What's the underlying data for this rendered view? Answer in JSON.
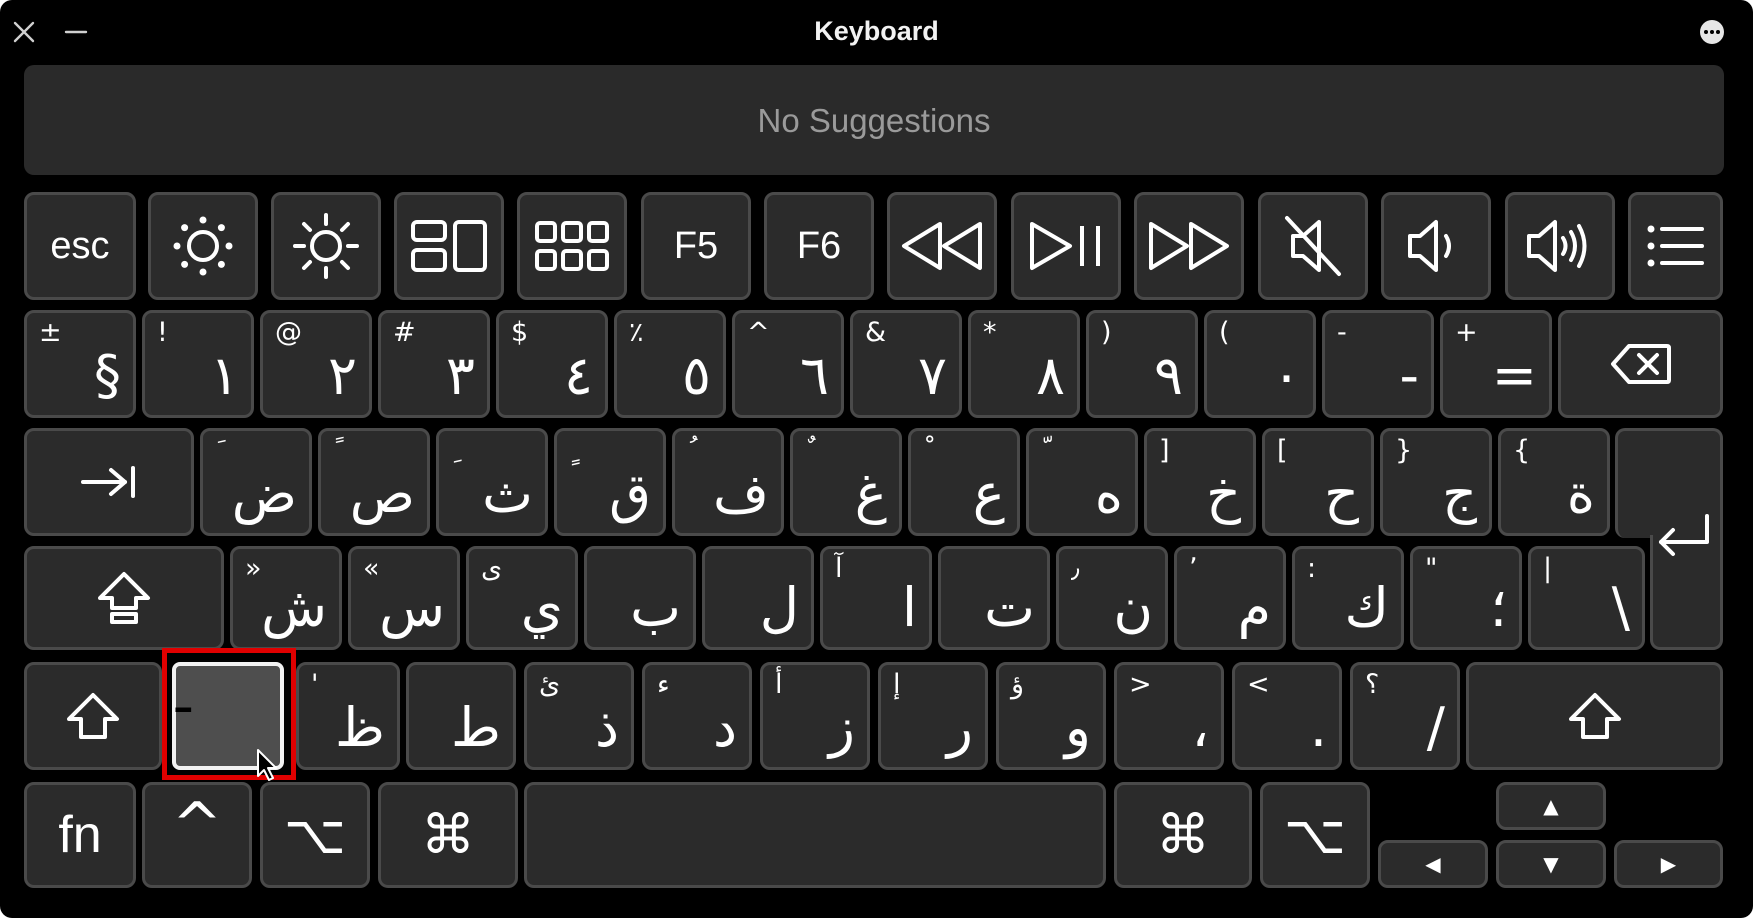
{
  "window": {
    "title": "Keyboard"
  },
  "suggestions": {
    "text": "No Suggestions"
  },
  "function_row": [
    {
      "name": "esc-key",
      "label": "esc"
    },
    {
      "name": "brightness-down-icon",
      "label": ""
    },
    {
      "name": "brightness-up-icon",
      "label": ""
    },
    {
      "name": "mission-control-icon",
      "label": ""
    },
    {
      "name": "launchpad-icon",
      "label": ""
    },
    {
      "name": "f5-key",
      "label": "F5"
    },
    {
      "name": "f6-key",
      "label": "F6"
    },
    {
      "name": "rewind-icon",
      "label": ""
    },
    {
      "name": "play-pause-icon",
      "label": ""
    },
    {
      "name": "fast-forward-icon",
      "label": ""
    },
    {
      "name": "mute-icon",
      "label": ""
    },
    {
      "name": "volume-down-icon",
      "label": ""
    },
    {
      "name": "volume-up-icon",
      "label": ""
    },
    {
      "name": "list-icon",
      "label": ""
    }
  ],
  "number_row": [
    {
      "shift": "±",
      "main": "§"
    },
    {
      "shift": "!",
      "main": "١"
    },
    {
      "shift": "@",
      "main": "٢"
    },
    {
      "shift": "#",
      "main": "٣"
    },
    {
      "shift": "$",
      "main": "٤"
    },
    {
      "shift": "٪",
      "main": "٥"
    },
    {
      "shift": "^",
      "main": "٦"
    },
    {
      "shift": "&",
      "main": "٧"
    },
    {
      "shift": "*",
      "main": "٨"
    },
    {
      "shift": ")",
      "main": "٩"
    },
    {
      "shift": "(",
      "main": "٠"
    },
    {
      "shift": "-",
      "main": "-"
    },
    {
      "shift": "+",
      "main": "="
    }
  ],
  "top_row": [
    {
      "shift": "َ",
      "main": "ض"
    },
    {
      "shift": "ً",
      "main": "ص"
    },
    {
      "shift": "ِ",
      "main": "ث"
    },
    {
      "shift": "ٍ",
      "main": "ق"
    },
    {
      "shift": "ُ",
      "main": "ف"
    },
    {
      "shift": "ٌ",
      "main": "غ"
    },
    {
      "shift": "ْ",
      "main": "ع"
    },
    {
      "shift": "ّ",
      "main": "ه"
    },
    {
      "shift": "]",
      "main": "خ"
    },
    {
      "shift": "[",
      "main": "ح"
    },
    {
      "shift": "}",
      "main": "ج"
    },
    {
      "shift": "{",
      "main": "ة"
    }
  ],
  "home_row": [
    {
      "shift": "»",
      "main": "ش"
    },
    {
      "shift": "«",
      "main": "س"
    },
    {
      "shift": "ى",
      "main": "ي"
    },
    {
      "shift": "",
      "main": "ب"
    },
    {
      "shift": "",
      "main": "ل"
    },
    {
      "shift": "آ",
      "main": "ا"
    },
    {
      "shift": "",
      "main": "ت"
    },
    {
      "shift": "٫",
      "main": "ن"
    },
    {
      "shift": "٬",
      "main": "م"
    },
    {
      "shift": ":",
      "main": "ك"
    },
    {
      "shift": "\"",
      "main": "؛"
    },
    {
      "shift": "|",
      "main": "\\"
    }
  ],
  "bottom_row": [
    {
      "shift": "'",
      "main": "ظ"
    },
    {
      "shift": "",
      "main": "ط"
    },
    {
      "shift": "ئ",
      "main": "ذ"
    },
    {
      "shift": "ء",
      "main": "د"
    },
    {
      "shift": "أ",
      "main": "ز"
    },
    {
      "shift": "إ",
      "main": "ر"
    },
    {
      "shift": "ؤ",
      "main": "و"
    },
    {
      "shift": ">",
      "main": "،"
    },
    {
      "shift": "<",
      "main": "."
    },
    {
      "shift": "؟",
      "main": "/"
    }
  ],
  "highlighted_key": {
    "main": "ـ"
  },
  "modifiers": {
    "fn": "fn",
    "control": "^",
    "option": "⌥",
    "command": "⌘",
    "arrow_up": "▲",
    "arrow_down": "▼",
    "arrow_left": "◀",
    "arrow_right": "▶"
  },
  "colors": {
    "window_bg": "#000000",
    "key_bg": "#2b2b2b",
    "key_border": "#4a4a4a",
    "highlight": "#e00000"
  }
}
